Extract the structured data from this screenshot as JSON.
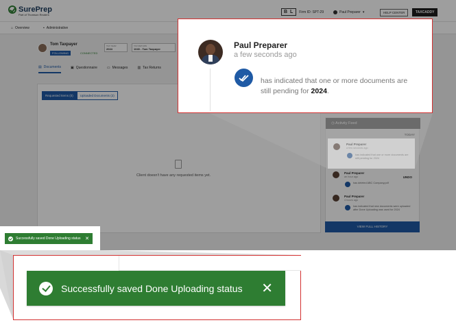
{
  "header": {
    "logo_text": "SurePrep",
    "logo_sub": "Part of Thomson Reuters",
    "firm_badge": "B L",
    "firm_id": "Firm ID: SPT-29",
    "user_menu": "Paul Preparer",
    "help_center": "HELP CENTER",
    "taxcaddy": "TAXCADDY"
  },
  "nav": {
    "overview": "Overview",
    "administrative": "Administrative"
  },
  "client": {
    "name": "Tom Taxpayer",
    "following": "FOLLOWING",
    "connected": "CONNECTED",
    "tax_year_label": "TAX YEAR",
    "tax_year": "2024",
    "tax_return_label": "TAX RETURN",
    "tax_return": "1040 - Tom Taxpayer"
  },
  "tabs": [
    "Documents",
    "Questionnaire",
    "Messages",
    "Tax Returns"
  ],
  "subtabs": {
    "requested": "Requested Items (0)",
    "uploaded": "Uploaded Documents (2)"
  },
  "empty_state": "Client doesn't have any requested items yet.",
  "activity_feed": {
    "title": "Activity Feed",
    "today": "TODAY",
    "items": [
      {
        "name": "Paul Preparer",
        "time": "a few seconds ago",
        "message": "has indicated that one or more documents are still pending for 2024",
        "undo": ""
      },
      {
        "name": "Paul Preparer",
        "time": "an hour ago",
        "message": "has deleted ABC Company.pdf",
        "undo": "UNDO"
      },
      {
        "name": "Paul Preparer",
        "time": "4 hours ago",
        "message": "has indicated that new documents were uploaded after Done Uploading was used for 2024",
        "undo": ""
      }
    ],
    "footer": "VIEW FULL HISTORY"
  },
  "callout": {
    "name": "Paul Preparer",
    "time": "a few seconds ago",
    "message": "has indicated that one or more documents are still pending for",
    "year": "2024",
    "period": "."
  },
  "toast": {
    "message": "Successfully saved Done Uploading status",
    "close": "✕"
  },
  "colors": {
    "toast_green": "#2e7d32",
    "brand_blue": "#1f5aa5",
    "callout_border": "#d32f2f"
  }
}
